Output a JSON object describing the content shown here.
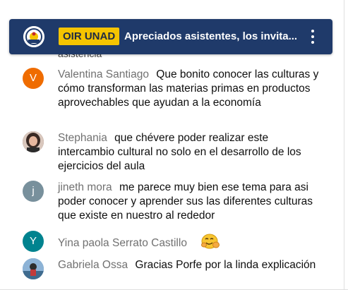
{
  "pinned": {
    "badge": "OIR UNAD",
    "text": "Apreciados asistentes, los invita...",
    "avatar_icon": "unad-logo-icon"
  },
  "previous_fragment": "asistencia",
  "messages": [
    {
      "author": "Valentina Santiago",
      "text": "Que bonito conocer las culturas y cómo transforman las materias primas en productos aprovechables que ayudan a la economía",
      "avatar_letter": "V",
      "avatar_color": "#ef6c00"
    },
    {
      "author": "Stephania",
      "text": "que chévere poder realizar este intercambio cultural no solo en el desarrollo de los ejercicios del aula",
      "avatar_letter": "",
      "avatar_color": "#7a5a50"
    },
    {
      "author": "jineth mora",
      "text": "me parece muy bien ese tema para asi poder conocer y aprender sus las diferentes culturas que existe en nuestro al rededor",
      "avatar_letter": "j",
      "avatar_color": "#78909c"
    },
    {
      "author": "Yina paola Serrato Castillo",
      "text": "",
      "emoji": "hugging-face-emoji",
      "avatar_letter": "Y",
      "avatar_color": "#00838f"
    },
    {
      "author": "Gabriela Ossa",
      "text": "Gracias Porfe por la linda explicación",
      "avatar_letter": "",
      "avatar_color": "#5d8fb5"
    }
  ]
}
